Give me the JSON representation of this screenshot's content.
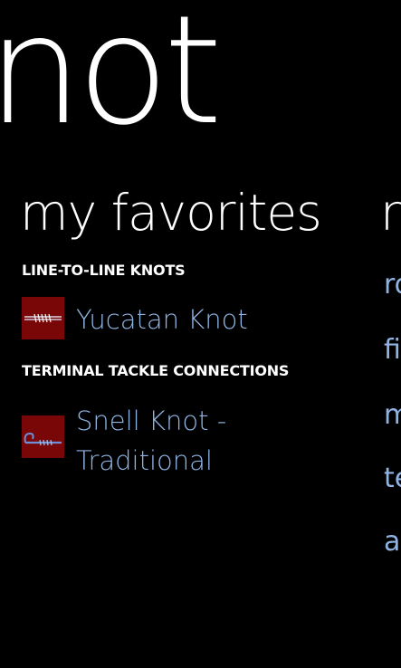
{
  "app": {
    "panorama_title": "not"
  },
  "favorites": {
    "header": "my favorites",
    "groups": [
      {
        "title": "LINE-TO-LINE KNOTS",
        "items": [
          {
            "label": "Yucatan Knot",
            "icon": "yucatan-knot-thumbnail"
          }
        ]
      },
      {
        "title": "TERMINAL TACKLE CONNECTIONS",
        "items": [
          {
            "label_line1": "Snell Knot -",
            "label_line2": "Traditional",
            "icon": "snell-knot-thumbnail"
          }
        ]
      }
    ]
  },
  "next_section": {
    "header": "n",
    "items": [
      "ro",
      "fi",
      "m",
      "te",
      "a"
    ]
  },
  "colors": {
    "background": "#000000",
    "foreground": "#ffffff",
    "accent": "#8fb4e3",
    "thumbnail_bg": "#7a0707"
  }
}
